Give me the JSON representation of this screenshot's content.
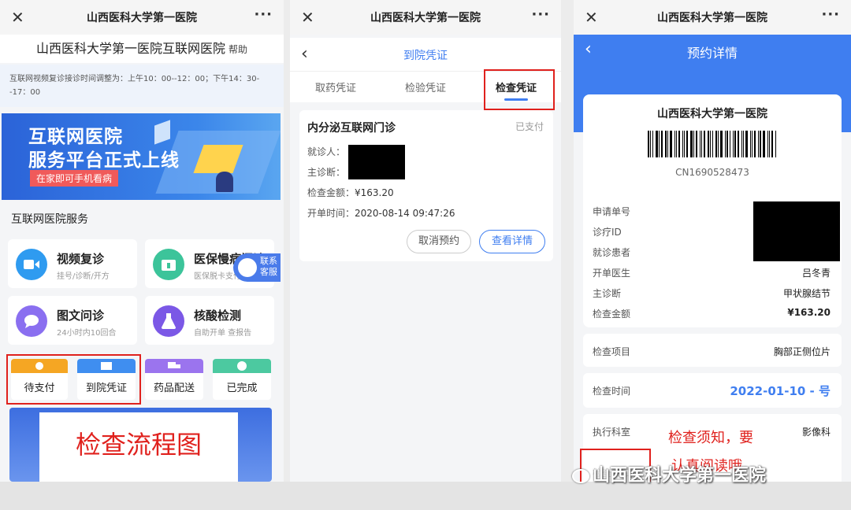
{
  "screen1": {
    "wx_title": "山西医科大学第一医院",
    "close": "✕",
    "more": "···",
    "page_title": "山西医科大学第一医院互联网医院",
    "help": "帮助",
    "notice": "互联网视频复诊接诊时间调整为：上午10：00--12：00；下午14：30--17：00",
    "banner": {
      "line1": "互联网医院",
      "line2": "服务平台正式上线",
      "tag": "在家即可手机看病"
    },
    "section_title": "互联网医院服务",
    "services": [
      {
        "name": "视频复诊",
        "sub": "挂号/诊断/开方"
      },
      {
        "name": "医保慢病门诊",
        "sub": "医保脱卡支付"
      },
      {
        "name": "图文问诊",
        "sub": "24小时内10回合"
      },
      {
        "name": "核酸检测",
        "sub": "自助开单 查报告"
      }
    ],
    "float_service": {
      "line1": "联系",
      "line2": "客服"
    },
    "tabs": [
      "待支付",
      "到院凭证",
      "药品配送",
      "已完成"
    ],
    "flow_label": "检查流程图"
  },
  "screen2": {
    "wx_title": "山西医科大学第一医院",
    "close": "✕",
    "more": "···",
    "back": "‹",
    "nav_title": "到院凭证",
    "tabs": [
      "取药凭证",
      "检验凭证",
      "检查凭证"
    ],
    "card": {
      "title": "内分泌互联网门诊",
      "status": "已支付",
      "patient_label": "就诊人：",
      "diagnosis_label": "主诊断：",
      "amount_label": "检查金额：",
      "amount": "¥163.20",
      "time_label": "开单时间：",
      "time": "2020-08-14 09:47:26",
      "cancel": "取消预约",
      "view": "查看详情"
    }
  },
  "screen3": {
    "wx_title": "山西医科大学第一医院",
    "close": "✕",
    "more": "···",
    "back": "‹",
    "nav_title": "预约详情",
    "hospital": "山西医科大学第一医院",
    "code": "CN1690528473",
    "rows": [
      {
        "k": "申请单号",
        "v": ""
      },
      {
        "k": "诊疗ID",
        "v": ""
      },
      {
        "k": "就诊患者",
        "v": ""
      },
      {
        "k": "开单医生",
        "v": "吕冬青"
      },
      {
        "k": "主诊断",
        "v": "甲状腺结节"
      },
      {
        "k": "检查金额",
        "v": "¥163.20"
      }
    ],
    "item_label": "检查项目",
    "item_value": "胸部正侧位片",
    "time_label": "检查时间",
    "time_value": "2022-01-10 - 号",
    "dept_label": "执行科室",
    "dept_value": "影像科",
    "notice_label": "检查须知",
    "annot1": "检查须知，要",
    "annot2": "认真阅读哦",
    "watermark": "山西医科大学第一医院"
  },
  "colors": {
    "primary": "#3f7ef0",
    "annotation": "#e0211d"
  }
}
